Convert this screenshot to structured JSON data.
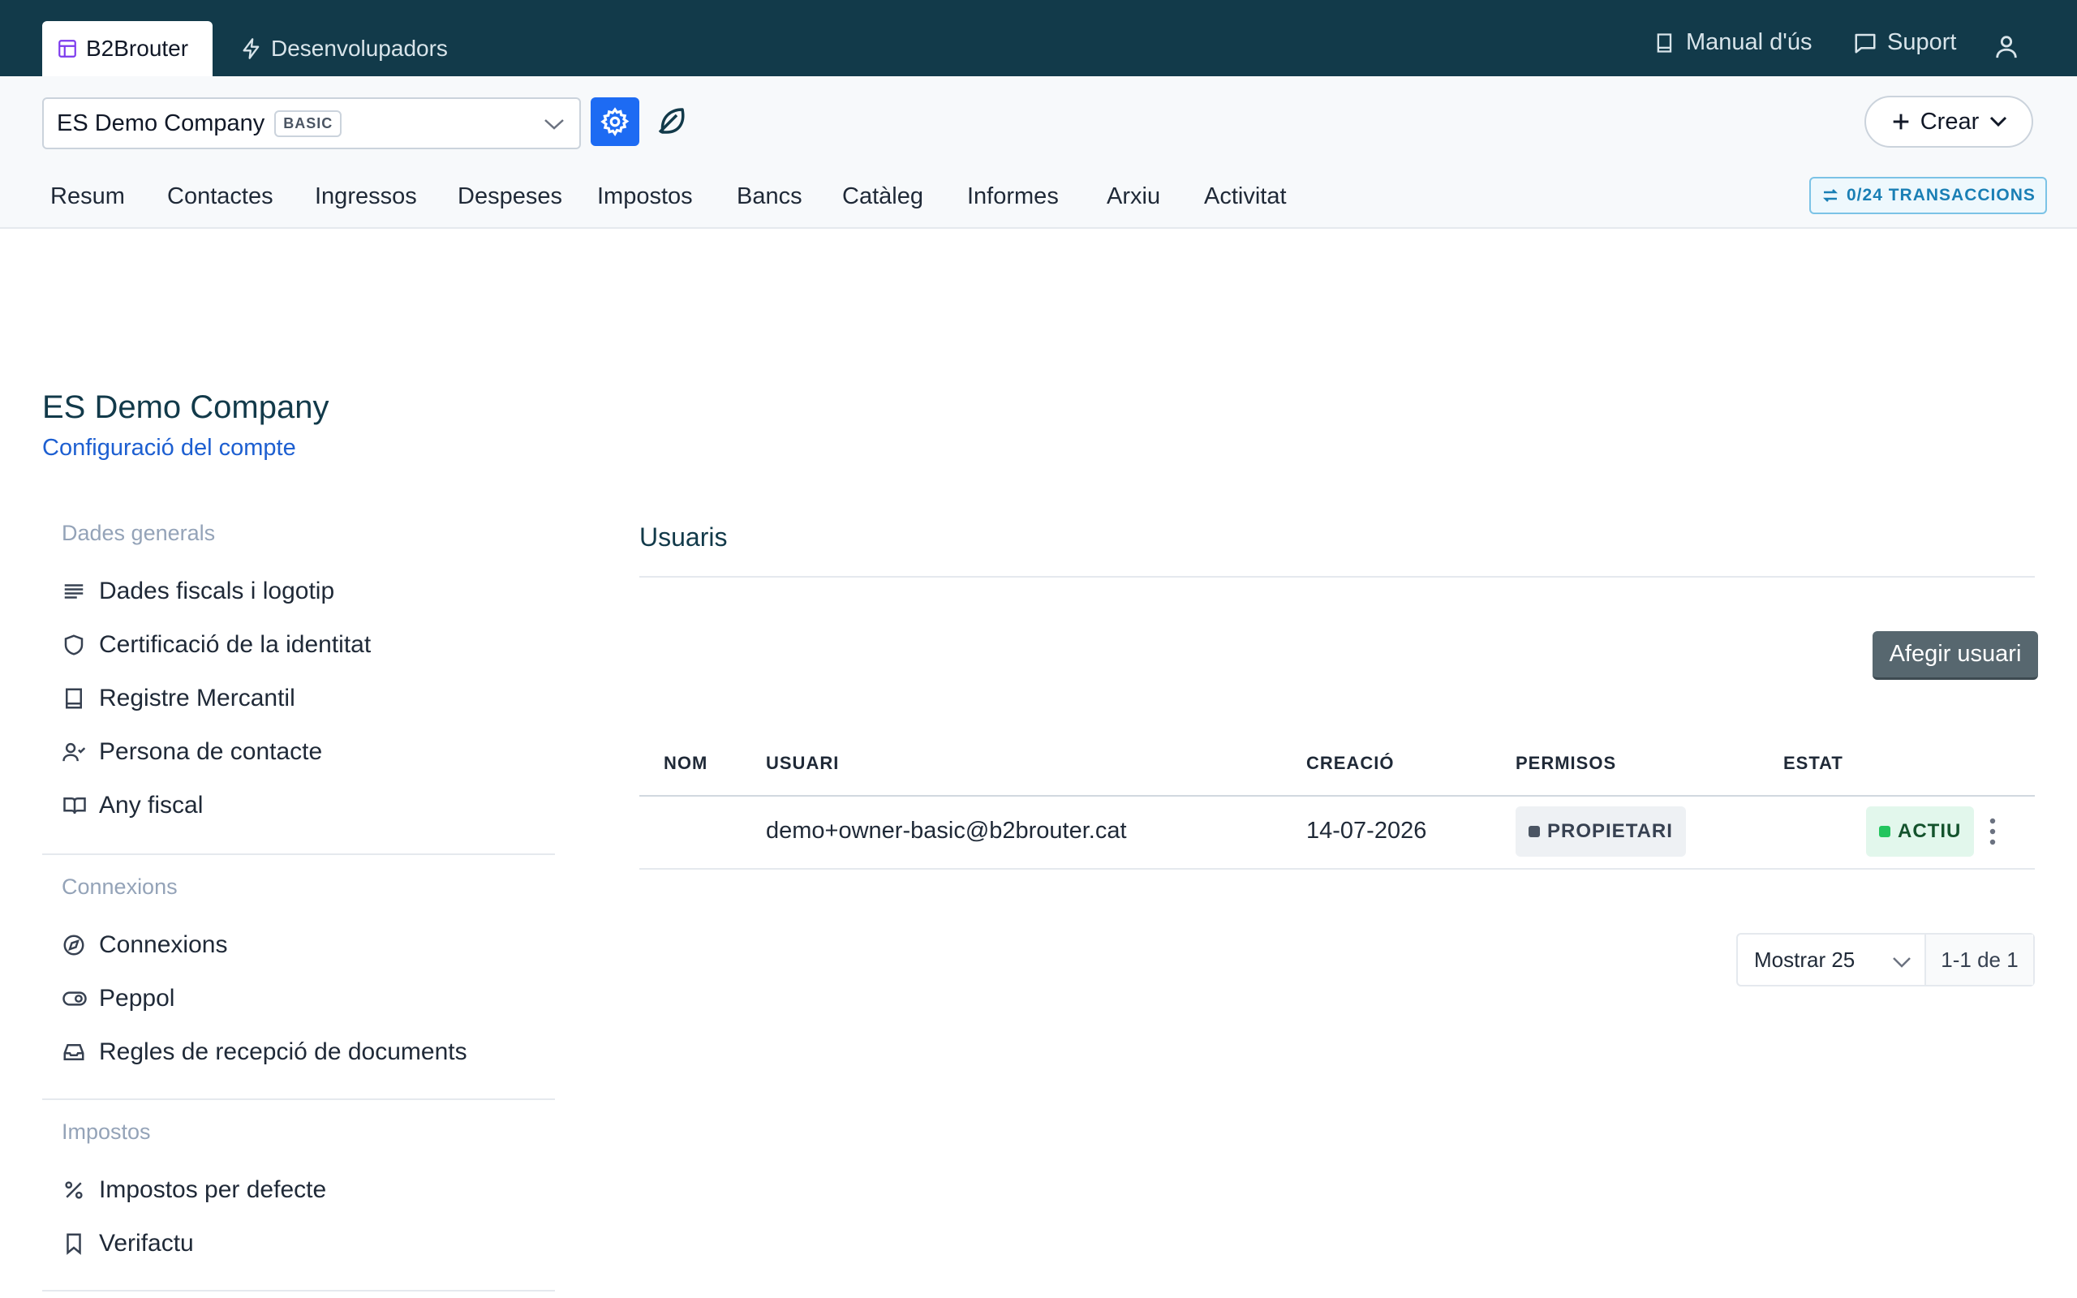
{
  "topbar": {
    "tabs": [
      {
        "label": "B2Brouter"
      },
      {
        "label": "Desenvolupadors"
      }
    ],
    "links": [
      {
        "label": "Manual d'ús"
      },
      {
        "label": "Suport"
      }
    ]
  },
  "company_selector": {
    "name": "ES Demo Company",
    "plan": "BASIC"
  },
  "create_button": {
    "label": "Crear"
  },
  "nav": [
    "Resum",
    "Contactes",
    "Ingressos",
    "Despeses",
    "Impostos",
    "Bancs",
    "Catàleg",
    "Informes",
    "Arxiu",
    "Activitat"
  ],
  "transactions_badge": "0/24 TRANSACCIONS",
  "page": {
    "title": "ES Demo Company",
    "subtitle": "Configuració del compte"
  },
  "sidebar": {
    "sections": [
      {
        "heading": "Dades generals",
        "items": [
          "Dades fiscals i logotip",
          "Certificació de la identitat",
          "Registre Mercantil",
          "Persona de contacte",
          "Any fiscal"
        ]
      },
      {
        "heading": "Connexions",
        "items": [
          "Connexions",
          "Peppol",
          "Regles de recepció de documents"
        ]
      },
      {
        "heading": "Impostos",
        "items": [
          "Impostos per defecte",
          "Verifactu"
        ]
      }
    ]
  },
  "users": {
    "title": "Usuaris",
    "add_button": "Afegir usuari",
    "columns": [
      "NOM",
      "USUARI",
      "CREACIÓ",
      "PERMISOS",
      "ESTAT"
    ],
    "rows": [
      {
        "name": "",
        "user": "demo+owner-basic@b2brouter.cat",
        "created": "14-07-2026",
        "permission": "PROPIETARI",
        "status": "ACTIU"
      }
    ]
  },
  "pagination": {
    "show": "Mostrar 25",
    "range": "1-1 de 1"
  },
  "colors": {
    "topbar": "#123a4a",
    "accent": "#1d6bf3",
    "link": "#1d5fd1",
    "status_active": "#22c55e",
    "permission": "#4b5563"
  }
}
